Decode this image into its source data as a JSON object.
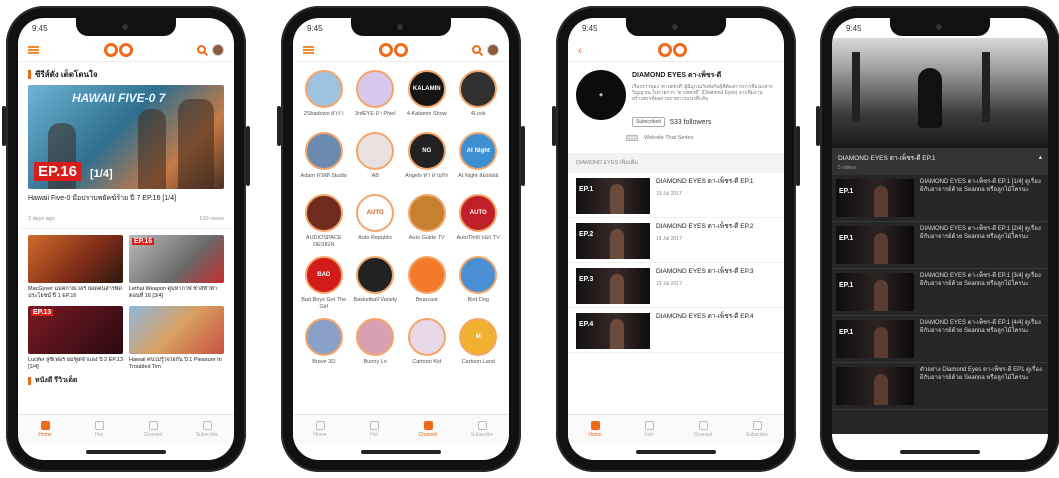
{
  "status_time": "9:45",
  "tabs": [
    "Home",
    "Hot",
    "Channel",
    "Subscribe"
  ],
  "phone1": {
    "section_title": "ซีรีส์ดัง เด็ดโดนใจ",
    "hero_brand": "HAWAII FIVE-0 7",
    "hero_badge": "EP.16",
    "hero_part": "[1/4]",
    "hero_caption": "Hawaii Five-0 มือปราบพยัคฆ์ร้าย ปี 7 EP.16 [1/4]",
    "hero_date": "2 days ago",
    "hero_views": "530 views",
    "cards": [
      {
        "ep": "",
        "title": "MacGyver แมคกายเวอร์ ยอดคนสารพัดประโยชน์ ปี 1 EP.16"
      },
      {
        "ep": "EP.16",
        "title": "Lethal Weapon คู่มหากาฬ ซ่าส์ท้าฟ้า ตอนที่ 16 [3/4]"
      },
      {
        "ep": "EP.13",
        "title": "Lucifer ลูซิเฟอร์ ยมฑูตจำแลง ปี 2 EP.13 [1/4]"
      },
      {
        "ep": "",
        "title": "Hawaii คนไม่รู้ใจใจกัน ปี 1 Pleasure In Troubled Tim"
      }
    ],
    "section2_title": "หนังดี รีวิวเด็ด"
  },
  "phone2": {
    "channels": [
      {
        "name": "2Shadows ฝ่ากา",
        "color": "#9fc3de",
        "glyph": ""
      },
      {
        "name": "3rdEYE ถ้า Phiel",
        "color": "#d8c8ec",
        "glyph": ""
      },
      {
        "name": "4-Kalamin Show",
        "color": "#151515",
        "glyph": "KALAMIN"
      },
      {
        "name": "4Look",
        "color": "#303030",
        "glyph": ""
      },
      {
        "name": "Adam สวัสดี Studio",
        "color": "#6a8ab0",
        "glyph": ""
      },
      {
        "name": "AB",
        "color": "#e9e0e0",
        "glyph": ""
      },
      {
        "name": "Angels ท่า สามก๊ก",
        "color": "#222222",
        "glyph": "NG"
      },
      {
        "name": "At Night ล่องลอย",
        "color": "#3d8fd4",
        "glyph": "At Night"
      },
      {
        "name": "AUDIOSPACE DESIGN",
        "color": "#6e2b1e",
        "glyph": ""
      },
      {
        "name": "Auto Republic",
        "color": "#ffffff",
        "glyph": "AUTO"
      },
      {
        "name": "Auto Guide TV",
        "color": "#c6802f",
        "glyph": ""
      },
      {
        "name": "AutoThrill บอก TV",
        "color": "#c0202a",
        "glyph": "AUTO"
      },
      {
        "name": "Bad Boys Got The Girl",
        "color": "#d21c1c",
        "glyph": "BAD"
      },
      {
        "name": "Basketball Variety",
        "color": "#222222",
        "glyph": ""
      },
      {
        "name": "Bearcast",
        "color": "#f27a28",
        "glyph": ""
      },
      {
        "name": "Bird Dog",
        "color": "#4a8fd4",
        "glyph": ""
      },
      {
        "name": "Brave 3D",
        "color": "#8aa0c8",
        "glyph": ""
      },
      {
        "name": "Bunny Lo",
        "color": "#d8a0b0",
        "glyph": ""
      },
      {
        "name": "Cartoon Kid",
        "color": "#e8d8e8",
        "glyph": ""
      },
      {
        "name": "Cartoon Land",
        "color": "#f0b030",
        "glyph": "M"
      }
    ]
  },
  "phone3": {
    "channel_name": "DIAMOND EYES ตา-เพ็ชร-ดี",
    "description": "เรื่องราวของ ‘ตาเพชรดี’ ผู้มีญาณวิเศษกับผู้ที่ต้องการการชี้แนะทางวิญญาณ ในรายการ “ตาเพชรดี” (Diamond Eyes) จากทีมงานสร้างสรรค์ผลงานรายการแนวลึกลับ",
    "subscribe_label": "Subscribed",
    "followers": "533 followers",
    "website_label": "Website That Series",
    "list_title": "DIAMOND EYES เพิ่มเติม",
    "episodes": [
      {
        "label": "EP.1",
        "title": "DIAMOND EYES ตา-เพ็ชร-ดี EP.1",
        "date": "19 Jul 2017"
      },
      {
        "label": "EP.2",
        "title": "DIAMOND EYES ตา-เพ็ชร-ดี EP.2",
        "date": "19 Jul 2017"
      },
      {
        "label": "EP.3",
        "title": "DIAMOND EYES ตา-เพ็ชร-ดี EP.3",
        "date": "19 Jul 2017"
      },
      {
        "label": "EP.4",
        "title": "DIAMOND EYES ตา-เพ็ชร-ดี EP.4",
        "date": ""
      }
    ]
  },
  "phone4": {
    "video_title": "DIAMOND EYES ตา-เพ็ชร-ดี EP.1",
    "video_sub": "5 videos",
    "items": [
      {
        "label": "EP.1",
        "text": "DIAMOND EYES ตา-เพ็ชร-ดี EP.1 [1/4] ดูเรื่องผีกับอาจารย์ด้วย Seanna หรือลูกไม้ใครนะ"
      },
      {
        "label": "EP.1",
        "text": "DIAMOND EYES ตา-เพ็ชร-ดี EP.1 [2/4] ดูเรื่องผีกับอาจารย์ด้วย Seanna หรือลูกไม้ใครนะ"
      },
      {
        "label": "EP.1",
        "text": "DIAMOND EYES ตา-เพ็ชร-ดี EP.1 [3/4] ดูเรื่องผีกับอาจารย์ด้วย Seanna หรือลูกไม้ใครนะ"
      },
      {
        "label": "EP.1",
        "text": "DIAMOND EYES ตา-เพ็ชร-ดี EP.1 [4/4] ดูเรื่องผีกับอาจารย์ด้วย Seanna หรือลูกไม้ใครนะ"
      },
      {
        "label": "",
        "text": "ตัวอย่าง Diamond Eyes ตา-เพ็ชร-ดี EP1 ดูเรื่องผีกับอาจารย์ด้วย Seanna หรือลูกไม้ใครนะ"
      }
    ]
  },
  "colors": {
    "accent": "#f06a1a",
    "badge_red": "#d91c1c",
    "dark_bg": "#262626"
  }
}
